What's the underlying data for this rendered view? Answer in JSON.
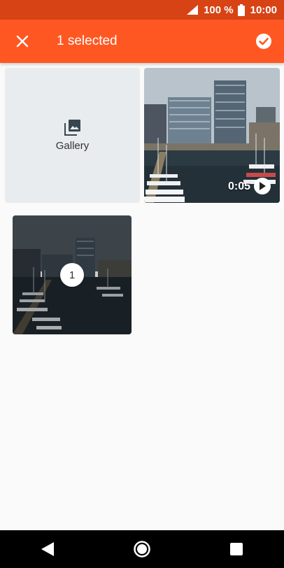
{
  "status_bar": {
    "battery_percent": "100 %",
    "time": "10:00",
    "icons": [
      "signal-icon",
      "battery-icon"
    ]
  },
  "app_bar": {
    "title": "1 selected",
    "icons": [
      "close-icon",
      "check-circle-icon"
    ],
    "colors": {
      "app_bar": "#ff5722",
      "status_bar": "#d84315"
    }
  },
  "grid": {
    "gallery_tile": {
      "label": "Gallery",
      "icon": "gallery-icon"
    },
    "video_tile": {
      "duration": "0:05",
      "icon": "play-icon"
    },
    "selected_tile": {
      "badge": "1"
    }
  },
  "nav_bar": {
    "icons": [
      "back-icon",
      "home-icon",
      "recents-icon"
    ]
  }
}
